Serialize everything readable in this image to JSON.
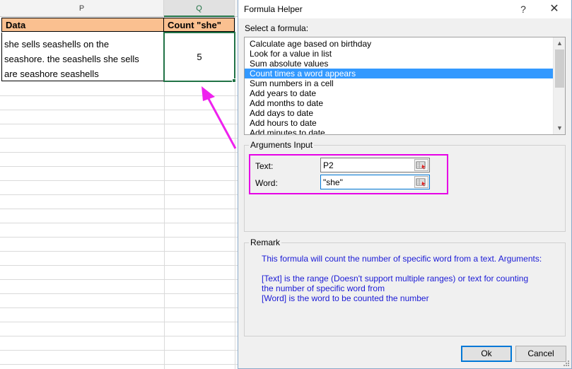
{
  "sheet": {
    "columns": [
      "P",
      "Q"
    ],
    "header": {
      "p": "Data",
      "q": "Count \"she\""
    },
    "row": {
      "p_lines": [
        "she sells seashells on the",
        "seashore. the seashells she sells",
        "are seashore seashells"
      ],
      "q": "5"
    }
  },
  "dialog": {
    "title": "Formula Helper",
    "help_glyph": "?",
    "close_glyph": "✕",
    "select_label": "Select a formula:",
    "formulas": [
      "Calculate age based on birthday",
      "Look for a value in list",
      "Sum absolute values",
      "Count times a word appears",
      "Sum numbers in a cell",
      "Add years to date",
      "Add months to date",
      "Add days to date",
      "Add hours to date",
      "Add minutes to date"
    ],
    "selected_index": 3,
    "arguments_title": "Arguments Input",
    "args": {
      "text_label": "Text:",
      "text_value": "P2",
      "word_label": "Word:",
      "word_value": "\"she\""
    },
    "remark_title": "Remark",
    "remark_lines": [
      "This formula will count the number of specific word from a text. Arguments:",
      "",
      "[Text] is the range (Doesn't support multiple ranges) or text for counting",
      "the number of specific word from",
      "[Word] is the word to be counted the number"
    ],
    "ok_label": "Ok",
    "cancel_label": "Cancel"
  },
  "colors": {
    "header_fill": "#fac090",
    "selection": "#217346",
    "list_selected": "#3399ff",
    "highlight": "#e600e6",
    "remark_text": "#1a1ad6"
  },
  "icons": {
    "range_select": "range-select-icon",
    "arrow": "magenta-arrow-icon"
  }
}
